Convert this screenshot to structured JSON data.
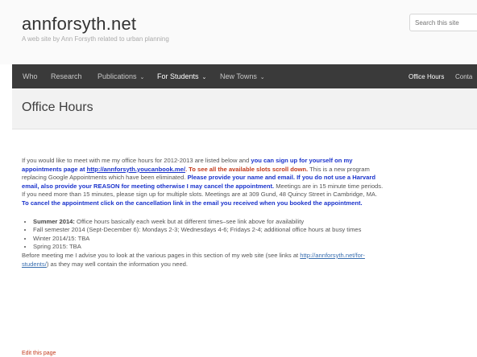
{
  "header": {
    "site_title": "annforsyth.net",
    "site_description": "A web site by Ann Forsyth related to urban planning",
    "search_placeholder": "Search this site"
  },
  "nav": {
    "items": [
      {
        "label": "Who"
      },
      {
        "label": "Research"
      },
      {
        "label": "Publications"
      },
      {
        "label": "For Students"
      },
      {
        "label": "New Towns"
      }
    ],
    "right_items": [
      {
        "label": "Office Hours"
      },
      {
        "label": "Conta"
      }
    ]
  },
  "page": {
    "title": "Office Hours"
  },
  "intro": {
    "p1": "If you would like to meet with me my office hours for 2012-2013 are listed below and ",
    "p2": "you can sign up for yourself on my appointments page at ",
    "p3": "http://annforsyth.youcanbook.me/",
    "p4": ". To see all the available slots scroll down.",
    "p5": " This is a new program replacing Google Appointments which have been eliminated. ",
    "p6": "Please provide your name and email.  If  you do not use a Harvard email, also provide your REASON for meeting otherwise I may cancel the appointment.",
    "p7": " Meetings are in 15 minute time periods. If you need more than 15 minutes, please sign up for multiple slots. Meetings are at 309 Gund, 48 Quincy Street in Cambridge, MA. ",
    "p8": "To cancel the appointment click on the cancellation link in the email you received when you booked the appointment."
  },
  "hours": {
    "summer_label": "Summer 2014:",
    "summer_text": " Office hours basically each week but at different times–see link above for availability",
    "fall": "Fall semester 2014 (Sept-December 6): Mondays 2-3; Wednesdays 4-6; Fridays 2-4; additional office hours at busy times",
    "winter": "Winter 2014/15: TBA",
    "spring": "Spring 2015: TBA"
  },
  "before": {
    "text1": "Before meeting me I advise you to look at the various pages in this section of my web site (see links at ",
    "link": "http://annforsyth.net/for-students/",
    "text2": ") as they may well contain the information you need."
  },
  "footer": {
    "edit_label": "Edit this page"
  }
}
